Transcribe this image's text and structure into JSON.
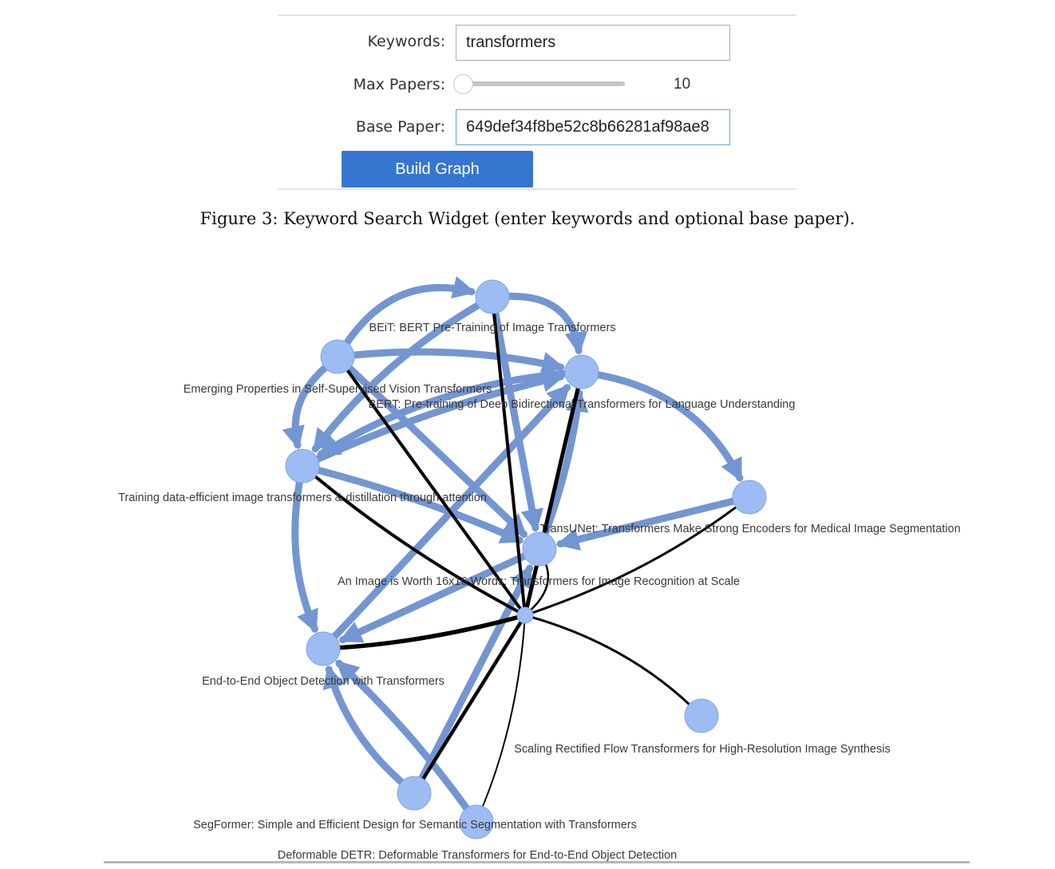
{
  "widget": {
    "keywords_label": "Keywords:",
    "keywords_value": "transformers",
    "max_papers_label": "Max Papers:",
    "max_papers_value": "10",
    "max_papers_slider_fraction": 0.0,
    "base_paper_label": "Base Paper:",
    "base_paper_value": "649def34f8be52c8b66281af98ae8",
    "build_button_label": "Build Graph",
    "accent_color": "#3576d1"
  },
  "figure3_caption": "Figure 3: Keyword Search Widget (enter keywords and optional base paper).",
  "graph": {
    "node_color": "#9dbcf4",
    "edge_color": "#7396d2",
    "black_edge_color": "#000000",
    "nodes": [
      {
        "id": "beit",
        "label": "BEiT: BERT Pre-Training of Image Transformers"
      },
      {
        "id": "dino",
        "label": "Emerging Properties in Self-Supervised Vision Transformers"
      },
      {
        "id": "bert",
        "label": "BERT: Pre-training of Deep Bidirectional Transformers for Language Understanding"
      },
      {
        "id": "deit",
        "label": "Training data-efficient image transformers & distillation through attention"
      },
      {
        "id": "transunet",
        "label": "TransUNet: Transformers Make Strong Encoders for Medical Image Segmentation"
      },
      {
        "id": "vit",
        "label": "An Image is Worth 16x16 Words: Transformers for Image Recognition at Scale"
      },
      {
        "id": "detr",
        "label": "End-to-End Object Detection with Transformers"
      },
      {
        "id": "sd3",
        "label": "Scaling Rectified Flow Transformers for High-Resolution Image Synthesis"
      },
      {
        "id": "segformer",
        "label": "SegFormer: Simple and Efficient Design for Semantic Segmentation with Transformers"
      },
      {
        "id": "ddetr",
        "label": "Deformable DETR: Deformable Transformers for End-to-End Object Detection"
      },
      {
        "id": "extra",
        "label": ""
      }
    ],
    "edges": [
      {
        "source": "dino",
        "target": "beit",
        "kind": "citation"
      },
      {
        "source": "beit",
        "target": "bert",
        "kind": "citation"
      },
      {
        "source": "dino",
        "target": "bert",
        "kind": "citation"
      },
      {
        "source": "deit",
        "target": "bert",
        "kind": "citation"
      },
      {
        "source": "bert",
        "target": "deit",
        "kind": "citation"
      },
      {
        "source": "beit",
        "target": "deit",
        "kind": "citation"
      },
      {
        "source": "dino",
        "target": "deit",
        "kind": "citation"
      },
      {
        "source": "dino",
        "target": "transunet",
        "kind": "citation"
      },
      {
        "source": "deit",
        "target": "transunet",
        "kind": "citation"
      },
      {
        "source": "beit",
        "target": "transunet",
        "kind": "citation"
      },
      {
        "source": "extra",
        "target": "transunet",
        "kind": "citation"
      },
      {
        "source": "transunet",
        "target": "bert",
        "kind": "citation"
      },
      {
        "source": "detr",
        "target": "bert",
        "kind": "citation"
      },
      {
        "source": "deit",
        "target": "detr",
        "kind": "citation"
      },
      {
        "source": "transunet",
        "target": "detr",
        "kind": "citation"
      },
      {
        "source": "segformer",
        "target": "detr",
        "kind": "citation"
      },
      {
        "source": "ddetr",
        "target": "detr",
        "kind": "citation"
      },
      {
        "source": "segformer",
        "target": "transunet",
        "kind": "citation"
      },
      {
        "source": "bert",
        "target": "extra",
        "kind": "citation"
      },
      {
        "source": "beit",
        "target": "vit",
        "kind": "similarity"
      },
      {
        "source": "dino",
        "target": "vit",
        "kind": "similarity"
      },
      {
        "source": "deit",
        "target": "vit",
        "kind": "similarity"
      },
      {
        "source": "bert",
        "target": "vit",
        "kind": "similarity"
      },
      {
        "source": "transunet",
        "target": "vit",
        "kind": "similarity"
      },
      {
        "source": "extra",
        "target": "vit",
        "kind": "similarity"
      },
      {
        "source": "detr",
        "target": "vit",
        "kind": "similarity"
      },
      {
        "source": "sd3",
        "target": "vit",
        "kind": "similarity"
      },
      {
        "source": "segformer",
        "target": "vit",
        "kind": "similarity"
      },
      {
        "source": "ddetr",
        "target": "vit",
        "kind": "similarity"
      }
    ]
  }
}
